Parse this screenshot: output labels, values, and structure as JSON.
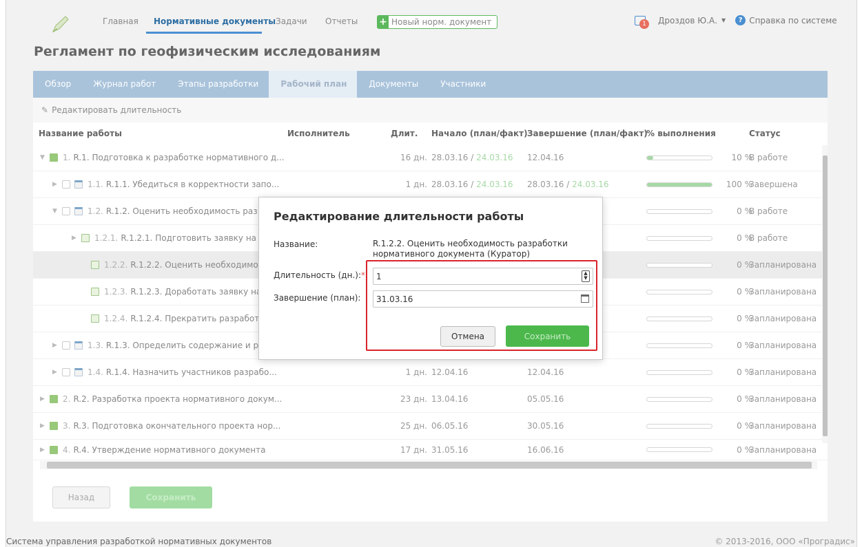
{
  "nav": {
    "items": [
      "Главная",
      "Нормативные документы",
      "Задачи",
      "Отчеты"
    ],
    "new_doc": "Новый норм. документ",
    "notifications_count": "1",
    "user": "Дроздов Ю.А.",
    "help": "Справка по системе"
  },
  "page_title": "Регламент по геофизическим исследованиям",
  "tabs": [
    "Обзор",
    "Журнал работ",
    "Этапы разработки",
    "Рабочий план",
    "Документы",
    "Участники"
  ],
  "active_tab": "Рабочий план",
  "toolbar": {
    "edit_duration": "Редактировать длительность"
  },
  "table": {
    "headers": [
      "Название работы",
      "Исполнитель",
      "Длит.",
      "Начало (план/факт)",
      "Завершение (план/факт)",
      "% выполнения",
      "Статус"
    ],
    "rows": [
      {
        "num": "1.",
        "name": "R.1. Подготовка к разработке нормативного д...",
        "dur": "16 дн.",
        "start": "28.03.16",
        "start_fact": "24.03.16",
        "end": "12.04.16",
        "end_fact": "",
        "pct": "10 %",
        "progress": 0.1,
        "status": "В работе"
      },
      {
        "num": "1.1.",
        "name": "R.1.1. Убедиться в корректности запо...",
        "dur": "1 дн.",
        "start": "28.03.16",
        "start_fact": "24.03.16",
        "end": "28.03.16",
        "end_fact": "24.03.16",
        "pct": "100 %",
        "progress": 1.0,
        "status": "Завершена"
      },
      {
        "num": "1.2.",
        "name": "R.1.2. Оценить необходимость раз",
        "dur": "",
        "start": "",
        "start_fact": "",
        "end": "",
        "end_fact": "",
        "pct": "0 %",
        "progress": 0,
        "status": "В работе"
      },
      {
        "num": "1.2.1.",
        "name": "R.1.2.1. Подготовить заявку на р",
        "dur": "",
        "start": "",
        "start_fact": "",
        "end": "",
        "end_fact": "",
        "pct": "0 %",
        "progress": 0,
        "status": "В работе"
      },
      {
        "num": "1.2.2.",
        "name": "R.1.2.2. Оценить необходимост",
        "dur": "",
        "start": "",
        "start_fact": "",
        "end": "",
        "end_fact": "",
        "pct": "0 %",
        "progress": 0,
        "status": "Запланирована"
      },
      {
        "num": "1.2.3.",
        "name": "R.1.2.3. Доработать заявку на р",
        "dur": "",
        "start": "",
        "start_fact": "",
        "end": "",
        "end_fact": "",
        "pct": "0 %",
        "progress": 0,
        "status": "Запланирована"
      },
      {
        "num": "1.2.4.",
        "name": "R.1.2.4. Прекратить разработку",
        "dur": "",
        "start": "",
        "start_fact": "",
        "end": "",
        "end_fact": "",
        "pct": "0 %",
        "progress": 0,
        "status": "Запланирована"
      },
      {
        "num": "1.3.",
        "name": "R.1.3. Определить содержание и р",
        "dur": "",
        "start": "",
        "start_fact": "",
        "end": "",
        "end_fact": "",
        "pct": "0 %",
        "progress": 0,
        "status": "Запланирована"
      },
      {
        "num": "1.4.",
        "name": "R.1.4. Назначить участников разрабо...",
        "dur": "1 дн.",
        "start": "12.04.16",
        "start_fact": "",
        "end": "12.04.16",
        "end_fact": "",
        "pct": "0 %",
        "progress": 0,
        "status": "Запланирована"
      },
      {
        "num": "2.",
        "name": "R.2. Разработка проекта нормативного докум...",
        "dur": "23 дн.",
        "start": "13.04.16",
        "start_fact": "",
        "end": "05.05.16",
        "end_fact": "",
        "pct": "0 %",
        "progress": 0,
        "status": "Запланирована"
      },
      {
        "num": "3.",
        "name": "R.3. Подготовка окончательного проекта нор...",
        "dur": "25 дн.",
        "start": "06.05.16",
        "start_fact": "",
        "end": "30.05.16",
        "end_fact": "",
        "pct": "0 %",
        "progress": 0,
        "status": "Запланирована"
      },
      {
        "num": "4.",
        "name": "R.4. Утверждение нормативного документа",
        "dur": "17 дн.",
        "start": "31.05.16",
        "start_fact": "",
        "end": "16.06.16",
        "end_fact": "",
        "pct": "0 %",
        "progress": 0,
        "status": "Запланирована"
      }
    ]
  },
  "buttons": {
    "back": "Назад",
    "save": "Сохранить"
  },
  "dialog": {
    "title": "Редактирование длительности работы",
    "name_label": "Название:",
    "name_value": "R.1.2.2. Оценить необходимость разработки нормативного документа (Куратор)",
    "duration_label": "Длительность (дн.):",
    "duration_value": "1",
    "end_label": "Завершение (план):",
    "end_value": "31.03.16",
    "cancel": "Отмена",
    "save": "Сохранить"
  },
  "footer": {
    "left": "Система управления разработкой нормативных документов",
    "right": "© 2013-2016, ООО «Проградис»"
  },
  "colors": {
    "accent": "#4a8fd0",
    "tabs_bg": "#a9c3db",
    "success": "#5cb85c",
    "highlight_frame": "#d9232a"
  }
}
